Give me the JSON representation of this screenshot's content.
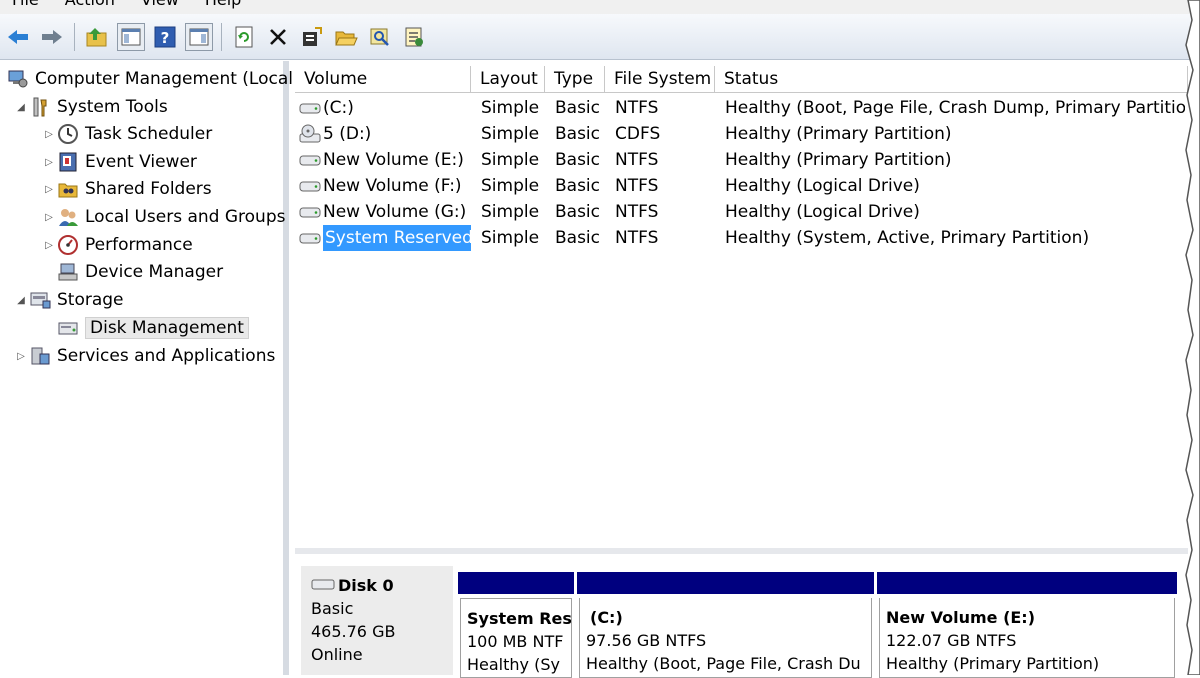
{
  "menu": [
    "File",
    "Action",
    "View",
    "Help"
  ],
  "toolbar": {
    "icons": [
      "back-arrow-icon",
      "forward-arrow-icon",
      "up-folder-icon",
      "show-hide-tree-icon",
      "help-icon",
      "action-pane-icon",
      "refresh-icon",
      "delete-icon",
      "properties-icon",
      "open-folder-icon",
      "search-icon",
      "export-list-icon"
    ]
  },
  "tree": {
    "root": "Computer Management (Local",
    "system_tools": "System Tools",
    "task_scheduler": "Task Scheduler",
    "event_viewer": "Event Viewer",
    "shared_folders": "Shared Folders",
    "local_users": "Local Users and Groups",
    "performance": "Performance",
    "device_manager": "Device Manager",
    "storage": "Storage",
    "disk_management": "Disk Management",
    "services": "Services and Applications"
  },
  "columns": [
    "Volume",
    "Layout",
    "Type",
    "File System",
    "Status"
  ],
  "volumes": [
    {
      "volume": "(C:)",
      "layout": "Simple",
      "type": "Basic",
      "fs": "NTFS",
      "status": "Healthy (Boot, Page File, Crash Dump, Primary Partition)"
    },
    {
      "volume": "5 (D:)",
      "layout": "Simple",
      "type": "Basic",
      "fs": "CDFS",
      "status": "Healthy (Primary Partition)"
    },
    {
      "volume": "New Volume (E:)",
      "layout": "Simple",
      "type": "Basic",
      "fs": "NTFS",
      "status": "Healthy (Primary Partition)"
    },
    {
      "volume": "New Volume (F:)",
      "layout": "Simple",
      "type": "Basic",
      "fs": "NTFS",
      "status": "Healthy (Logical Drive)"
    },
    {
      "volume": "New Volume (G:)",
      "layout": "Simple",
      "type": "Basic",
      "fs": "NTFS",
      "status": "Healthy (Logical Drive)"
    },
    {
      "volume": "System Reserved",
      "layout": "Simple",
      "type": "Basic",
      "fs": "NTFS",
      "status": "Healthy (System, Active, Primary Partition)"
    }
  ],
  "disk": {
    "name": "Disk 0",
    "type": "Basic",
    "size": "465.76 GB",
    "state": "Online"
  },
  "partitions": [
    {
      "name": "System Res",
      "size": "100 MB NTF",
      "status": "Healthy (Sy"
    },
    {
      "name": "(C:)",
      "size": "97.56 GB NTFS",
      "status": "Healthy (Boot, Page File, Crash Du"
    },
    {
      "name": "New Volume  (E:)",
      "size": "122.07 GB NTFS",
      "status": "Healthy (Primary Partition)"
    }
  ],
  "colors": {
    "selection": "#3399ff",
    "partition_bar": "#00007f"
  }
}
